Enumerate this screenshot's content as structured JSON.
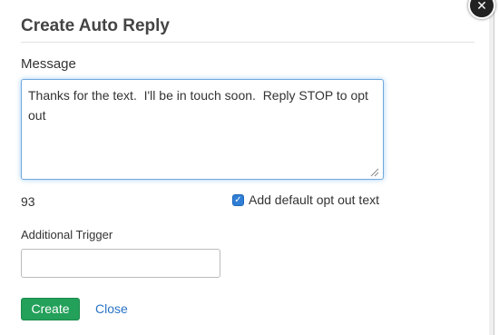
{
  "dialog": {
    "title": "Create Auto Reply",
    "close_symbol": "✕"
  },
  "message": {
    "label": "Message",
    "value": "Thanks for the text.  I'll be in touch soon.  Reply STOP to opt out",
    "char_count": "93"
  },
  "opt_out": {
    "checked": true,
    "label": "Add default opt out text"
  },
  "trigger": {
    "label": "Additional Trigger",
    "value": ""
  },
  "actions": {
    "create_label": "Create",
    "close_label": "Close"
  },
  "colors": {
    "create_button": "#23a05a",
    "link": "#2a73c4",
    "focus_border": "#6fa8dc"
  }
}
